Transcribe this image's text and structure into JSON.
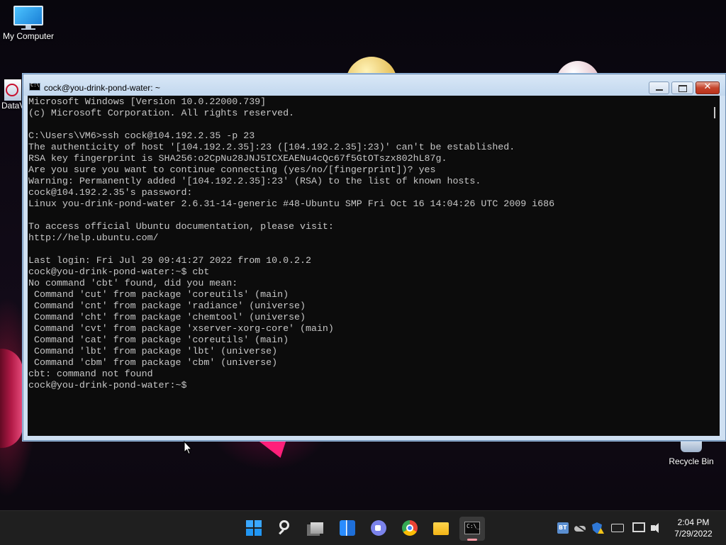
{
  "desktop": {
    "icons": [
      {
        "label": "My Computer"
      },
      {
        "label": "DataV"
      },
      {
        "label": "Recycle Bin"
      }
    ]
  },
  "console_window": {
    "title": "cock@you-drink-pond-water: ~",
    "close_glyph": "✕",
    "lines": [
      "Microsoft Windows [Version 10.0.22000.739]",
      "(c) Microsoft Corporation. All rights reserved.",
      "",
      "C:\\Users\\VM6>ssh cock@104.192.2.35 -p 23",
      "The authenticity of host '[104.192.2.35]:23 ([104.192.2.35]:23)' can't be established.",
      "RSA key fingerprint is SHA256:o2CpNu28JNJ5ICXEAENu4cQc67f5GtOTszx802hL87g.",
      "Are you sure you want to continue connecting (yes/no/[fingerprint])? yes",
      "Warning: Permanently added '[104.192.2.35]:23' (RSA) to the list of known hosts.",
      "cock@104.192.2.35's password:",
      "Linux you-drink-pond-water 2.6.31-14-generic #48-Ubuntu SMP Fri Oct 16 14:04:26 UTC 2009 i686",
      "",
      "To access official Ubuntu documentation, please visit:",
      "http://help.ubuntu.com/",
      "",
      "Last login: Fri Jul 29 09:41:27 2022 from 10.0.2.2",
      "cock@you-drink-pond-water:~$ cbt",
      "No command 'cbt' found, did you mean:",
      " Command 'cut' from package 'coreutils' (main)",
      " Command 'cnt' from package 'radiance' (universe)",
      " Command 'cht' from package 'chemtool' (universe)",
      " Command 'cvt' from package 'xserver-xorg-core' (main)",
      " Command 'cat' from package 'coreutils' (main)",
      " Command 'lbt' from package 'lbt' (universe)",
      " Command 'cbm' from package 'cbm' (universe)",
      "cbt: command not found",
      "cock@you-drink-pond-water:~$"
    ]
  },
  "taskbar": {
    "apps": [
      {
        "icon": "windows-start-icon"
      },
      {
        "icon": "search-icon"
      },
      {
        "icon": "task-view-icon"
      },
      {
        "icon": "widgets-icon"
      },
      {
        "icon": "teams-chat-icon"
      },
      {
        "icon": "chrome-icon"
      },
      {
        "icon": "file-explorer-icon"
      },
      {
        "icon": "command-prompt-icon",
        "active": true
      }
    ],
    "clock": {
      "time": "2:04 PM",
      "date": "7/29/2022"
    }
  },
  "colors": {
    "terminal_bg": "#0c0c0c",
    "terminal_fg": "#c8c8c8",
    "taskbar_bg": "#1f1f1f",
    "active_indicator": "#ff99a4"
  }
}
